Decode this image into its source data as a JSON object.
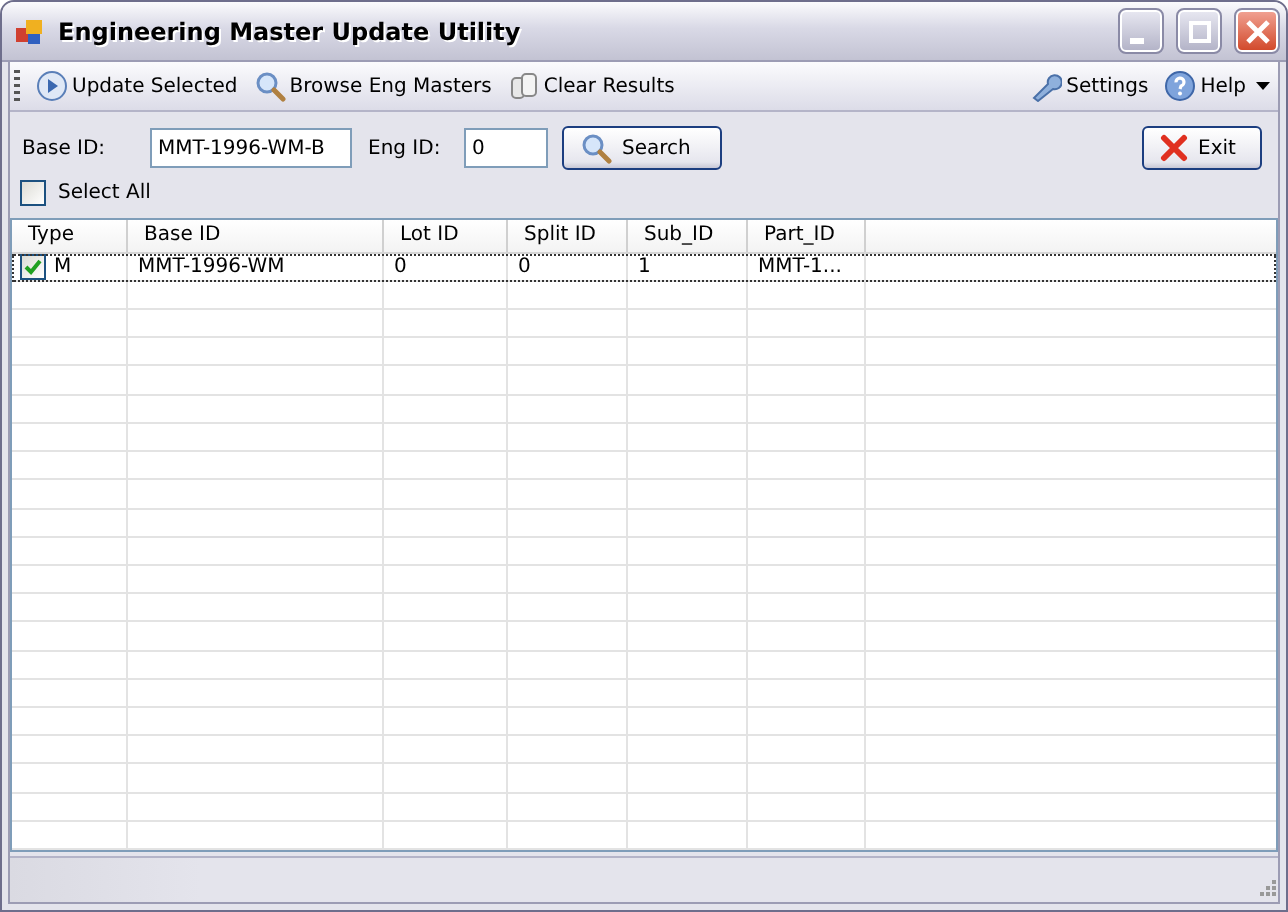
{
  "window": {
    "title": "Engineering Master Update Utility"
  },
  "toolbar": {
    "left": [
      {
        "label": "Update Selected",
        "kind": "play"
      },
      {
        "label": "Browse Eng Masters",
        "kind": "search"
      },
      {
        "label": "Clear Results",
        "kind": "clear"
      }
    ],
    "right": [
      {
        "label": "Settings",
        "kind": "wrench"
      },
      {
        "label": "Help",
        "kind": "help"
      }
    ]
  },
  "filters": {
    "base_id": {
      "label": "Base ID:",
      "value": "MMT-1996-WM-B"
    },
    "eng_id": {
      "label": "Eng ID:",
      "value": "0"
    },
    "search_button": "Search",
    "exit_button": "Exit",
    "select_all": {
      "label": "Select All",
      "checked": false
    }
  },
  "table": {
    "columns": [
      "Type",
      "Base ID",
      "Lot ID",
      "Split ID",
      "Sub_ID",
      "Part_ID"
    ],
    "rows": [
      {
        "checked": true,
        "cells": [
          "M",
          "MMT-1996-WM",
          "0",
          "0",
          "1",
          "MMT-1..."
        ]
      }
    ]
  }
}
